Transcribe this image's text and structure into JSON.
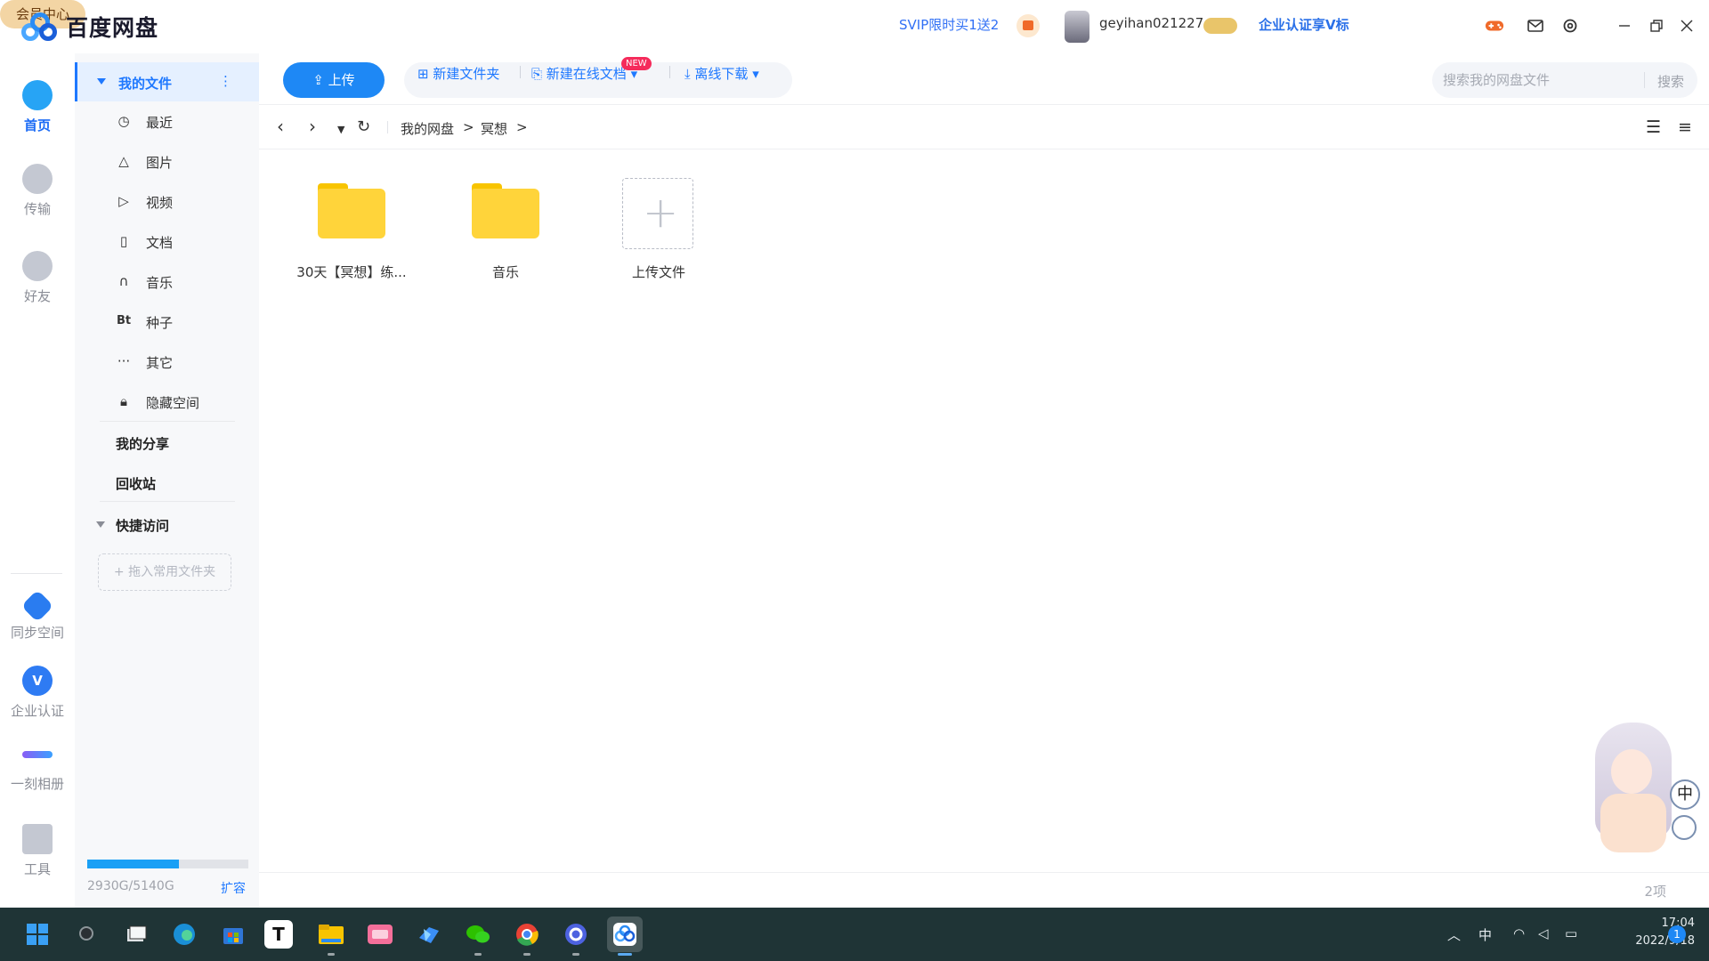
{
  "app": {
    "title": "百度网盘",
    "svip_promo": "SVIP限时买1送2",
    "username": "geyihan021227",
    "enterprise_promo": "企业认证享V标",
    "vip_center": "会员中心"
  },
  "leftnav": [
    {
      "label": "首页",
      "icon": "cloud-icon",
      "active": true
    },
    {
      "label": "传输",
      "icon": "transfer-icon",
      "active": false
    },
    {
      "label": "好友",
      "icon": "friends-icon",
      "active": false
    },
    {
      "label": "同步空间",
      "icon": "sync-icon",
      "active": false
    },
    {
      "label": "企业认证",
      "icon": "enterprise-v-icon",
      "active": false
    },
    {
      "label": "一刻相册",
      "icon": "album-icon",
      "active": false
    },
    {
      "label": "工具",
      "icon": "tools-icon",
      "active": false
    }
  ],
  "sidebar": {
    "my_files": "我的文件",
    "categories": [
      {
        "label": "最近",
        "icon": "clock-icon"
      },
      {
        "label": "图片",
        "icon": "image-icon"
      },
      {
        "label": "视频",
        "icon": "video-icon"
      },
      {
        "label": "文档",
        "icon": "document-icon"
      },
      {
        "label": "音乐",
        "icon": "headphones-icon"
      },
      {
        "label": "种子",
        "icon": "bt-icon",
        "glyph": "Bt"
      },
      {
        "label": "其它",
        "icon": "more-icon"
      },
      {
        "label": "隐藏空间",
        "icon": "lock-icon"
      }
    ],
    "my_share": "我的分享",
    "recycle_bin": "回收站",
    "quick_access": "快捷访问",
    "drop_hint": "+ 拖入常用文件夹",
    "storage_text": "2930G/5140G",
    "storage_used_fraction": 0.57,
    "expand": "扩容"
  },
  "toolbar": {
    "upload": "上传",
    "new_folder": "新建文件夹",
    "new_online_doc": "新建在线文档",
    "new_badge": "NEW",
    "offline_download": "离线下载",
    "search_placeholder": "搜索我的网盘文件",
    "search_button": "搜索"
  },
  "breadcrumb": [
    "我的网盘",
    "冥想"
  ],
  "files": [
    {
      "name": "30天【冥想】练...",
      "type": "folder"
    },
    {
      "name": "音乐",
      "type": "folder"
    },
    {
      "name": "上传文件",
      "type": "upload"
    }
  ],
  "status": {
    "item_count": "2项"
  },
  "taskbar": {
    "ime": "中",
    "time": "17:04",
    "date": "2022/9/18",
    "notifications": "1",
    "apps": [
      "start-icon",
      "search-icon",
      "task-view-icon",
      "edge-icon",
      "store-icon",
      "typora-icon",
      "file-explorer-icon",
      "bilibili-icon",
      "feishu-icon",
      "wechat-icon",
      "chrome-icon",
      "app-icon",
      "baidu-netdisk-icon"
    ]
  },
  "colors": {
    "accent": "#1e88f5",
    "folder": "#ffd43a",
    "taskbar": "#1f3436"
  }
}
